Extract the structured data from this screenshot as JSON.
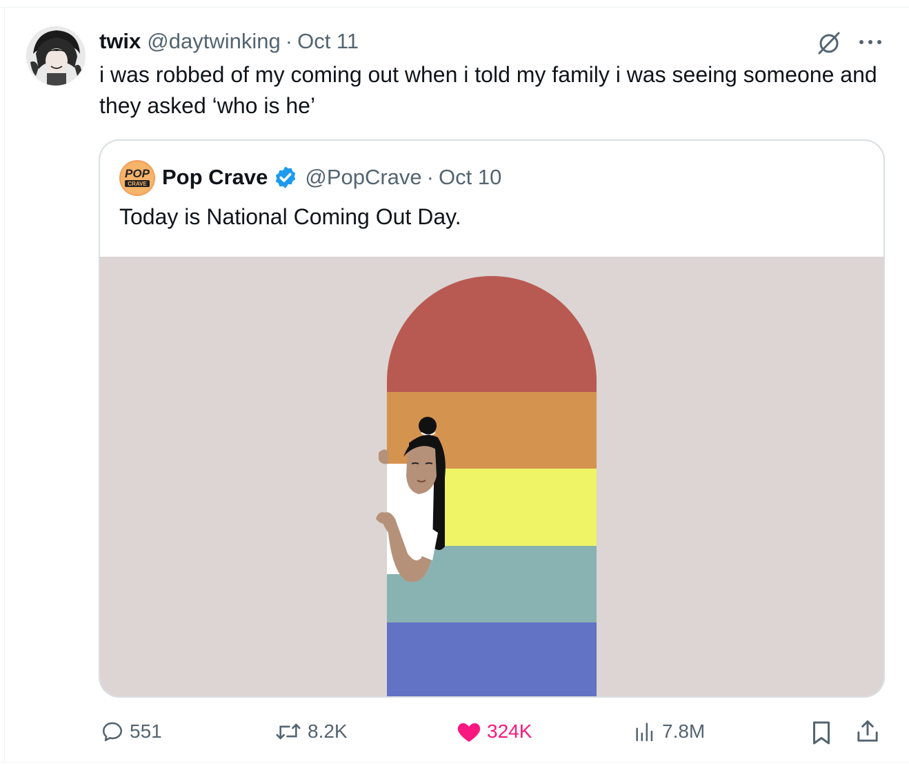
{
  "tweet": {
    "author_name": "twix",
    "author_handle": "@daytwinking",
    "separator": "·",
    "date": "Oct 11",
    "text": "i was robbed of my coming out when i told my family i was seeing someone and they asked ‘who is he’",
    "avatar_icon": "profile-photo"
  },
  "quote": {
    "author_name": "Pop Crave",
    "author_handle": "@PopCrave",
    "separator": "·",
    "date": "Oct 10",
    "text": "Today is National Coming Out Day.",
    "avatar_text_top": "POP",
    "avatar_text_bottom": "CRAVE",
    "verified_icon": "verified-badge-icon",
    "media_description_icon": "rainbow-doorway-illustration"
  },
  "actions": {
    "replies": "551",
    "reposts": "8.2K",
    "likes": "324K",
    "views": "7.8M"
  },
  "colors": {
    "muted": "#536471",
    "like_active": "#f91880",
    "verified": "#1d9bf0",
    "rainbow": [
      "#b95a52",
      "#d59350",
      "#eef466",
      "#89b3b3",
      "#6272c4"
    ],
    "media_bg": "#dcd5d3"
  }
}
